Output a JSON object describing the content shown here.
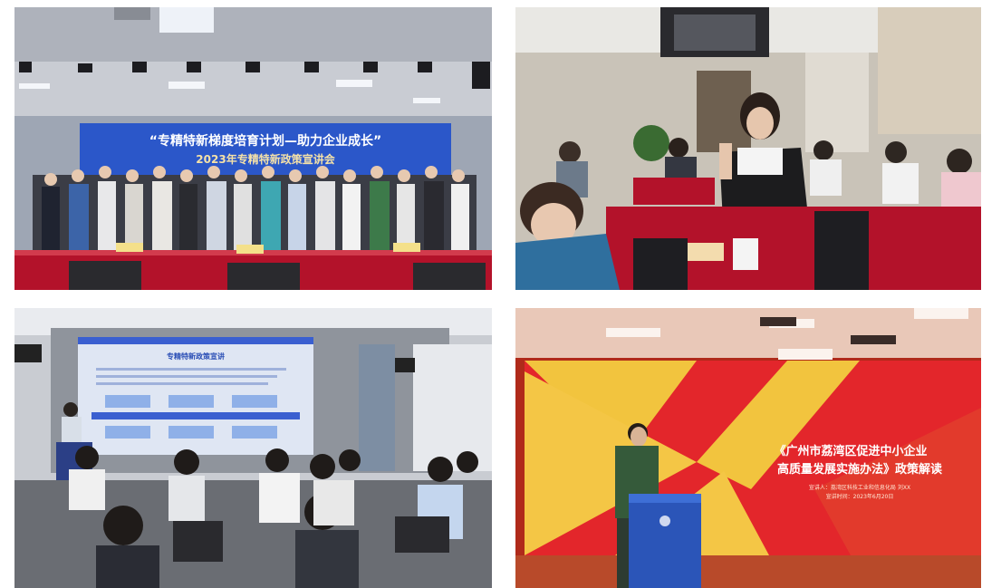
{
  "photos": [
    {
      "id": "group-photo",
      "banner_line1": "“专精特新梯度培育计划—助力企业成长”",
      "banner_line2": "2023年专精特新政策宣讲会"
    },
    {
      "id": "audience-question"
    },
    {
      "id": "presentation-session",
      "slide_title": "专精特新政策宣讲"
    },
    {
      "id": "speaker-podium",
      "screen_title_line1": "《广州市荔湾区促进中小企业",
      "screen_title_line2": "高质量发展实施办法》政策解读",
      "screen_sub_line1": "宣讲人：荔湾区科技工业和信息化局  刘XX",
      "screen_sub_line2": "宣讲时间：2023年6月20日"
    }
  ],
  "colors": {
    "table_red": "#b3122a",
    "screen_blue": "#3a5fd0",
    "screen_red": "#e3262b",
    "screen_yellow": "#f0c23a",
    "podium_blue": "#2b55b8"
  }
}
